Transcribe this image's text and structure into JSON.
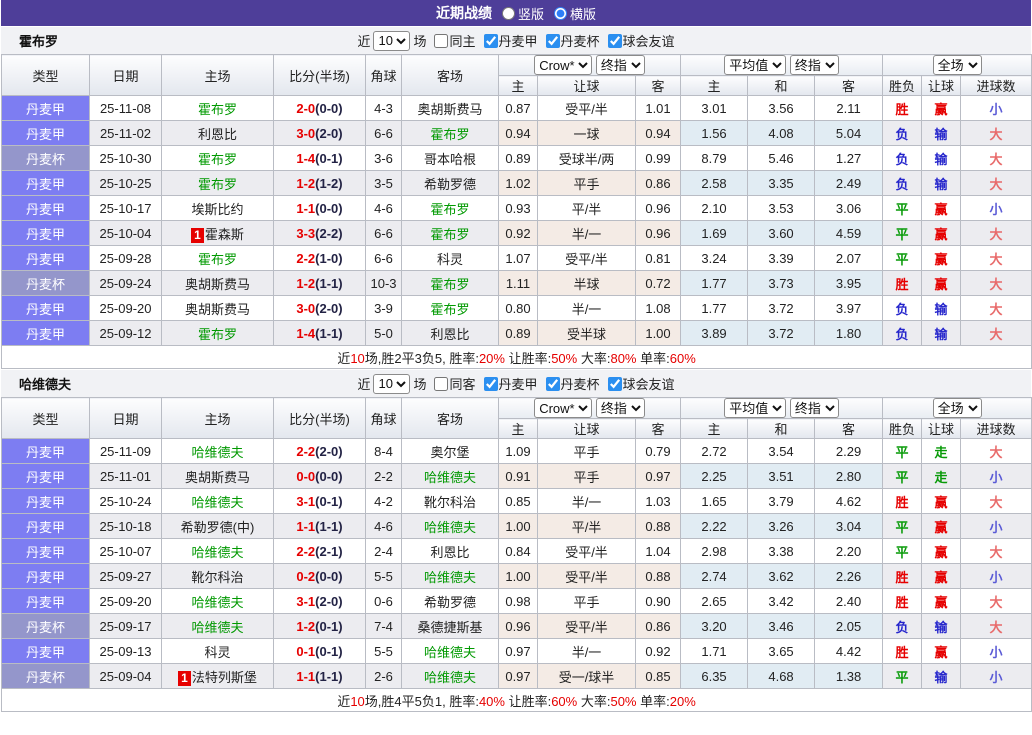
{
  "title_bar": {
    "title": "近期战绩",
    "radio_vertical": "竖版",
    "radio_horizontal": "横版",
    "vertical_checked": false,
    "horizontal_checked": true
  },
  "colors": {
    "accent": "#4e3e99",
    "league_badge": "#7d7df2",
    "cup_badge": "#9496cb",
    "focus_team": "#009900",
    "score_ft": "#e60000",
    "score_ht": "#222244",
    "win": "#e60000",
    "lose": "#2626cc",
    "draw": "#089a08",
    "big": "#e86a6a",
    "small": "#5b5bd6",
    "checkbox": "#2b8ff0"
  },
  "cup_label": "丹麦杯",
  "result_classes": {
    "胜": "win",
    "负": "lose",
    "平": "draw",
    "赢": "win",
    "输": "lose",
    "走": "draw",
    "大": "big",
    "小": "small"
  },
  "sections": [
    {
      "team": "霍布罗",
      "filter": {
        "prefix": "近",
        "count": "10",
        "suffix": "场",
        "same_label": "同主",
        "same_checked": false,
        "leagues": [
          {
            "label": "丹麦甲",
            "checked": true
          },
          {
            "label": "丹麦杯",
            "checked": true
          },
          {
            "label": "球会友谊",
            "checked": true
          }
        ]
      },
      "header": {
        "cols": [
          "类型",
          "日期",
          "主场",
          "比分(半场)",
          "角球",
          "客场"
        ],
        "dd_book": "Crow*",
        "dd_final1": "终指",
        "dd_avg": "平均值",
        "dd_final2": "终指",
        "dd_full": "全场",
        "sub": [
          "主",
          "让球",
          "客",
          "主",
          "和",
          "客",
          "胜负",
          "让球",
          "进球数"
        ]
      },
      "rows": [
        {
          "type": "丹麦甲",
          "date": "25-11-08",
          "home": "霍布罗",
          "home_focus": true,
          "home_badge": "",
          "ft": "2-0",
          "ht": "(0-0)",
          "corner": "4-3",
          "away": "奥胡斯费马",
          "away_focus": false,
          "away_badge": "",
          "crow": [
            "0.87",
            "受平/半",
            "1.01"
          ],
          "avg": [
            "3.01",
            "3.56",
            "2.11"
          ],
          "res": [
            "胜",
            "赢",
            "小"
          ]
        },
        {
          "type": "丹麦甲",
          "date": "25-11-02",
          "home": "利恩比",
          "home_focus": false,
          "home_badge": "",
          "ft": "3-0",
          "ht": "(2-0)",
          "corner": "6-6",
          "away": "霍布罗",
          "away_focus": true,
          "away_badge": "",
          "crow": [
            "0.94",
            "一球",
            "0.94"
          ],
          "avg": [
            "1.56",
            "4.08",
            "5.04"
          ],
          "res": [
            "负",
            "输",
            "大"
          ]
        },
        {
          "type": "丹麦杯",
          "date": "25-10-30",
          "home": "霍布罗",
          "home_focus": true,
          "home_badge": "",
          "ft": "1-4",
          "ht": "(0-1)",
          "corner": "3-6",
          "away": "哥本哈根",
          "away_focus": false,
          "away_badge": "",
          "crow": [
            "0.89",
            "受球半/两",
            "0.99"
          ],
          "avg": [
            "8.79",
            "5.46",
            "1.27"
          ],
          "res": [
            "负",
            "输",
            "大"
          ]
        },
        {
          "type": "丹麦甲",
          "date": "25-10-25",
          "home": "霍布罗",
          "home_focus": true,
          "home_badge": "",
          "ft": "1-2",
          "ht": "(1-2)",
          "corner": "3-5",
          "away": "希勒罗德",
          "away_focus": false,
          "away_badge": "",
          "crow": [
            "1.02",
            "平手",
            "0.86"
          ],
          "avg": [
            "2.58",
            "3.35",
            "2.49"
          ],
          "res": [
            "负",
            "输",
            "大"
          ]
        },
        {
          "type": "丹麦甲",
          "date": "25-10-17",
          "home": "埃斯比约",
          "home_focus": false,
          "home_badge": "",
          "ft": "1-1",
          "ht": "(0-0)",
          "corner": "4-6",
          "away": "霍布罗",
          "away_focus": true,
          "away_badge": "",
          "crow": [
            "0.93",
            "平/半",
            "0.96"
          ],
          "avg": [
            "2.10",
            "3.53",
            "3.06"
          ],
          "res": [
            "平",
            "赢",
            "小"
          ]
        },
        {
          "type": "丹麦甲",
          "date": "25-10-04",
          "home": "霍森斯",
          "home_focus": false,
          "home_badge": "1",
          "ft": "3-3",
          "ht": "(2-2)",
          "corner": "6-6",
          "away": "霍布罗",
          "away_focus": true,
          "away_badge": "",
          "crow": [
            "0.92",
            "半/一",
            "0.96"
          ],
          "avg": [
            "1.69",
            "3.60",
            "4.59"
          ],
          "res": [
            "平",
            "赢",
            "大"
          ]
        },
        {
          "type": "丹麦甲",
          "date": "25-09-28",
          "home": "霍布罗",
          "home_focus": true,
          "home_badge": "",
          "ft": "2-2",
          "ht": "(1-0)",
          "corner": "6-6",
          "away": "科灵",
          "away_focus": false,
          "away_badge": "",
          "crow": [
            "1.07",
            "受平/半",
            "0.81"
          ],
          "avg": [
            "3.24",
            "3.39",
            "2.07"
          ],
          "res": [
            "平",
            "赢",
            "大"
          ]
        },
        {
          "type": "丹麦杯",
          "date": "25-09-24",
          "home": "奥胡斯费马",
          "home_focus": false,
          "home_badge": "",
          "ft": "1-2",
          "ht": "(1-1)",
          "corner": "10-3",
          "away": "霍布罗",
          "away_focus": true,
          "away_badge": "",
          "crow": [
            "1.11",
            "半球",
            "0.72"
          ],
          "avg": [
            "1.77",
            "3.73",
            "3.95"
          ],
          "res": [
            "胜",
            "赢",
            "大"
          ]
        },
        {
          "type": "丹麦甲",
          "date": "25-09-20",
          "home": "奥胡斯费马",
          "home_focus": false,
          "home_badge": "",
          "ft": "3-0",
          "ht": "(2-0)",
          "corner": "3-9",
          "away": "霍布罗",
          "away_focus": true,
          "away_badge": "",
          "crow": [
            "0.80",
            "半/一",
            "1.08"
          ],
          "avg": [
            "1.77",
            "3.72",
            "3.97"
          ],
          "res": [
            "负",
            "输",
            "大"
          ]
        },
        {
          "type": "丹麦甲",
          "date": "25-09-12",
          "home": "霍布罗",
          "home_focus": true,
          "home_badge": "",
          "ft": "1-4",
          "ht": "(1-1)",
          "corner": "5-0",
          "away": "利恩比",
          "away_focus": false,
          "away_badge": "",
          "crow": [
            "0.89",
            "受半球",
            "1.00"
          ],
          "avg": [
            "3.89",
            "3.72",
            "1.80"
          ],
          "res": [
            "负",
            "输",
            "大"
          ]
        }
      ],
      "summary": [
        {
          "t": "近"
        },
        {
          "t": "10",
          "red": true
        },
        {
          "t": "场,胜2平3负5, 胜率:"
        },
        {
          "t": "20%",
          "red": true
        },
        {
          "t": " 让胜率:"
        },
        {
          "t": "50%",
          "red": true
        },
        {
          "t": " 大率:"
        },
        {
          "t": "80%",
          "red": true
        },
        {
          "t": " 单率:"
        },
        {
          "t": "60%",
          "red": true
        }
      ]
    },
    {
      "team": "哈维德夫",
      "filter": {
        "prefix": "近",
        "count": "10",
        "suffix": "场",
        "same_label": "同客",
        "same_checked": false,
        "leagues": [
          {
            "label": "丹麦甲",
            "checked": true
          },
          {
            "label": "丹麦杯",
            "checked": true
          },
          {
            "label": "球会友谊",
            "checked": true
          }
        ]
      },
      "header": {
        "cols": [
          "类型",
          "日期",
          "主场",
          "比分(半场)",
          "角球",
          "客场"
        ],
        "dd_book": "Crow*",
        "dd_final1": "终指",
        "dd_avg": "平均值",
        "dd_final2": "终指",
        "dd_full": "全场",
        "sub": [
          "主",
          "让球",
          "客",
          "主",
          "和",
          "客",
          "胜负",
          "让球",
          "进球数"
        ]
      },
      "rows": [
        {
          "type": "丹麦甲",
          "date": "25-11-09",
          "home": "哈维德夫",
          "home_focus": true,
          "home_badge": "",
          "ft": "2-2",
          "ht": "(2-0)",
          "corner": "8-4",
          "away": "奥尔堡",
          "away_focus": false,
          "away_badge": "",
          "crow": [
            "1.09",
            "平手",
            "0.79"
          ],
          "avg": [
            "2.72",
            "3.54",
            "2.29"
          ],
          "res": [
            "平",
            "走",
            "大"
          ]
        },
        {
          "type": "丹麦甲",
          "date": "25-11-01",
          "home": "奥胡斯费马",
          "home_focus": false,
          "home_badge": "",
          "ft": "0-0",
          "ht": "(0-0)",
          "corner": "2-2",
          "away": "哈维德夫",
          "away_focus": true,
          "away_badge": "",
          "crow": [
            "0.91",
            "平手",
            "0.97"
          ],
          "avg": [
            "2.25",
            "3.51",
            "2.80"
          ],
          "res": [
            "平",
            "走",
            "小"
          ]
        },
        {
          "type": "丹麦甲",
          "date": "25-10-24",
          "home": "哈维德夫",
          "home_focus": true,
          "home_badge": "",
          "ft": "3-1",
          "ht": "(0-1)",
          "corner": "4-2",
          "away": "靴尔科治",
          "away_focus": false,
          "away_badge": "",
          "crow": [
            "0.85",
            "半/一",
            "1.03"
          ],
          "avg": [
            "1.65",
            "3.79",
            "4.62"
          ],
          "res": [
            "胜",
            "赢",
            "大"
          ]
        },
        {
          "type": "丹麦甲",
          "date": "25-10-18",
          "home": "希勒罗德(中)",
          "home_focus": false,
          "home_badge": "",
          "ft": "1-1",
          "ht": "(1-1)",
          "corner": "4-6",
          "away": "哈维德夫",
          "away_focus": true,
          "away_badge": "",
          "crow": [
            "1.00",
            "平/半",
            "0.88"
          ],
          "avg": [
            "2.22",
            "3.26",
            "3.04"
          ],
          "res": [
            "平",
            "赢",
            "小"
          ]
        },
        {
          "type": "丹麦甲",
          "date": "25-10-07",
          "home": "哈维德夫",
          "home_focus": true,
          "home_badge": "",
          "ft": "2-2",
          "ht": "(2-1)",
          "corner": "2-4",
          "away": "利恩比",
          "away_focus": false,
          "away_badge": "",
          "crow": [
            "0.84",
            "受平/半",
            "1.04"
          ],
          "avg": [
            "2.98",
            "3.38",
            "2.20"
          ],
          "res": [
            "平",
            "赢",
            "大"
          ]
        },
        {
          "type": "丹麦甲",
          "date": "25-09-27",
          "home": "靴尔科治",
          "home_focus": false,
          "home_badge": "",
          "ft": "0-2",
          "ht": "(0-0)",
          "corner": "5-5",
          "away": "哈维德夫",
          "away_focus": true,
          "away_badge": "",
          "crow": [
            "1.00",
            "受平/半",
            "0.88"
          ],
          "avg": [
            "2.74",
            "3.62",
            "2.26"
          ],
          "res": [
            "胜",
            "赢",
            "小"
          ]
        },
        {
          "type": "丹麦甲",
          "date": "25-09-20",
          "home": "哈维德夫",
          "home_focus": true,
          "home_badge": "",
          "ft": "3-1",
          "ht": "(2-0)",
          "corner": "0-6",
          "away": "希勒罗德",
          "away_focus": false,
          "away_badge": "",
          "crow": [
            "0.98",
            "平手",
            "0.90"
          ],
          "avg": [
            "2.65",
            "3.42",
            "2.40"
          ],
          "res": [
            "胜",
            "赢",
            "大"
          ]
        },
        {
          "type": "丹麦杯",
          "date": "25-09-17",
          "home": "哈维德夫",
          "home_focus": true,
          "home_badge": "",
          "ft": "1-2",
          "ht": "(0-1)",
          "corner": "7-4",
          "away": "桑德捷斯基",
          "away_focus": false,
          "away_badge": "",
          "crow": [
            "0.96",
            "受平/半",
            "0.86"
          ],
          "avg": [
            "3.20",
            "3.46",
            "2.05"
          ],
          "res": [
            "负",
            "输",
            "大"
          ]
        },
        {
          "type": "丹麦甲",
          "date": "25-09-13",
          "home": "科灵",
          "home_focus": false,
          "home_badge": "",
          "ft": "0-1",
          "ht": "(0-1)",
          "corner": "5-5",
          "away": "哈维德夫",
          "away_focus": true,
          "away_badge": "",
          "crow": [
            "0.97",
            "半/一",
            "0.92"
          ],
          "avg": [
            "1.71",
            "3.65",
            "4.42"
          ],
          "res": [
            "胜",
            "赢",
            "小"
          ]
        },
        {
          "type": "丹麦杯",
          "date": "25-09-04",
          "home": "法特列斯堡",
          "home_focus": false,
          "home_badge": "1",
          "ft": "1-1",
          "ht": "(1-1)",
          "corner": "2-6",
          "away": "哈维德夫",
          "away_focus": true,
          "away_badge": "",
          "crow": [
            "0.97",
            "受一/球半",
            "0.85"
          ],
          "avg": [
            "6.35",
            "4.68",
            "1.38"
          ],
          "res": [
            "平",
            "输",
            "小"
          ]
        }
      ],
      "summary": [
        {
          "t": "近"
        },
        {
          "t": "10",
          "red": true
        },
        {
          "t": "场,胜4平5负1, 胜率:"
        },
        {
          "t": "40%",
          "red": true
        },
        {
          "t": " 让胜率:"
        },
        {
          "t": "60%",
          "red": true
        },
        {
          "t": " 大率:"
        },
        {
          "t": "50%",
          "red": true
        },
        {
          "t": " 单率:"
        },
        {
          "t": "20%",
          "red": true
        }
      ]
    }
  ]
}
